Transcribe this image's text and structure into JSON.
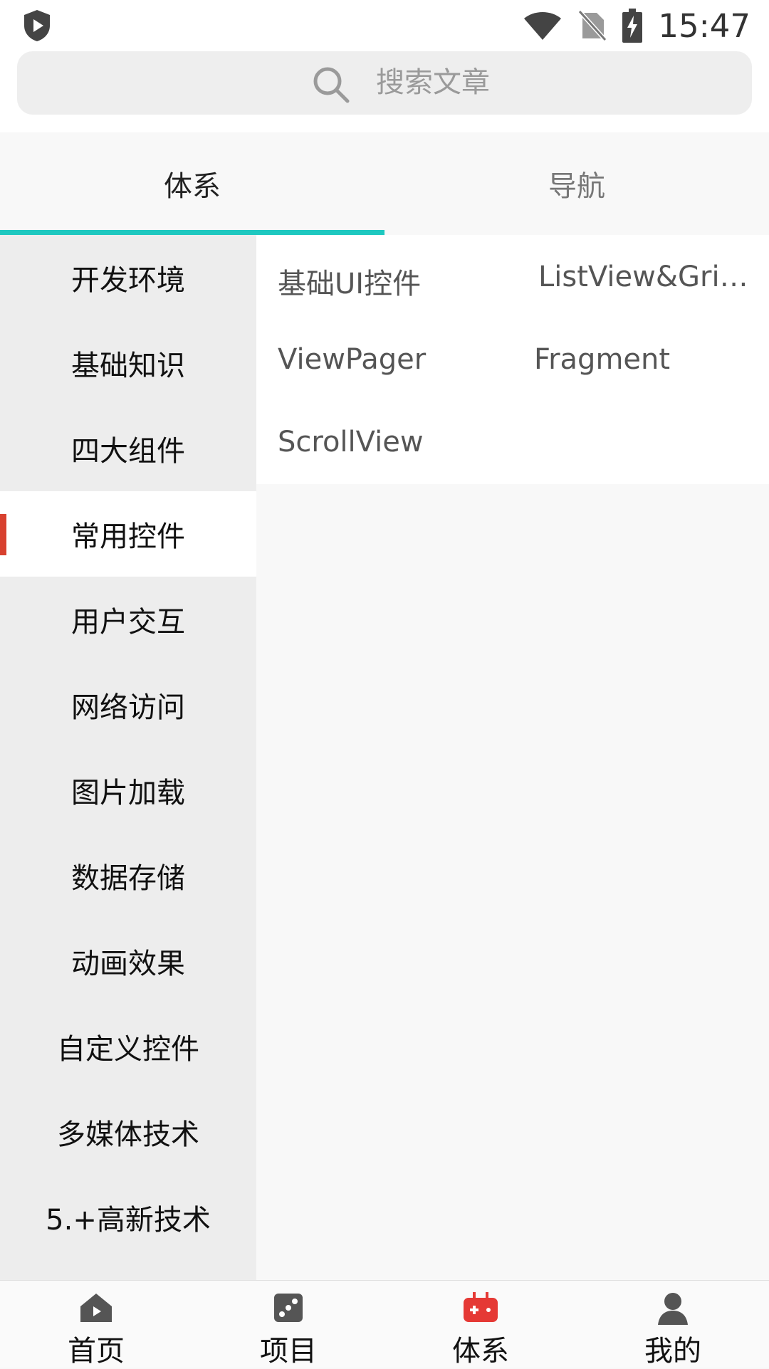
{
  "status_bar": {
    "time": "15:47"
  },
  "search": {
    "placeholder": "搜索文章"
  },
  "tabs": [
    {
      "label": "体系",
      "selected": true
    },
    {
      "label": "导航",
      "selected": false
    }
  ],
  "sidebar": {
    "items": [
      {
        "label": "开发环境"
      },
      {
        "label": "基础知识"
      },
      {
        "label": "四大组件"
      },
      {
        "label": "常用控件",
        "selected": true
      },
      {
        "label": "用户交互"
      },
      {
        "label": "网络访问"
      },
      {
        "label": "图片加载"
      },
      {
        "label": "数据存储"
      },
      {
        "label": "动画效果"
      },
      {
        "label": "自定义控件"
      },
      {
        "label": "多媒体技术"
      },
      {
        "label": "5.+高新技术"
      }
    ]
  },
  "content": {
    "chips": [
      {
        "label": "基础UI控件"
      },
      {
        "label": "ListView&GridView"
      },
      {
        "label": "ViewPager"
      },
      {
        "label": "Fragment"
      },
      {
        "label": "ScrollView"
      }
    ]
  },
  "bottom_nav": {
    "items": [
      {
        "label": "首页",
        "icon": "home-icon"
      },
      {
        "label": "项目",
        "icon": "dice-icon"
      },
      {
        "label": "体系",
        "icon": "gamepad-icon",
        "selected": true
      },
      {
        "label": "我的",
        "icon": "person-icon"
      }
    ]
  },
  "colors": {
    "tab_indicator": "#1ec8c0",
    "sidebar_active_marker": "#d8412f",
    "nav_active_icon": "#e53935"
  }
}
